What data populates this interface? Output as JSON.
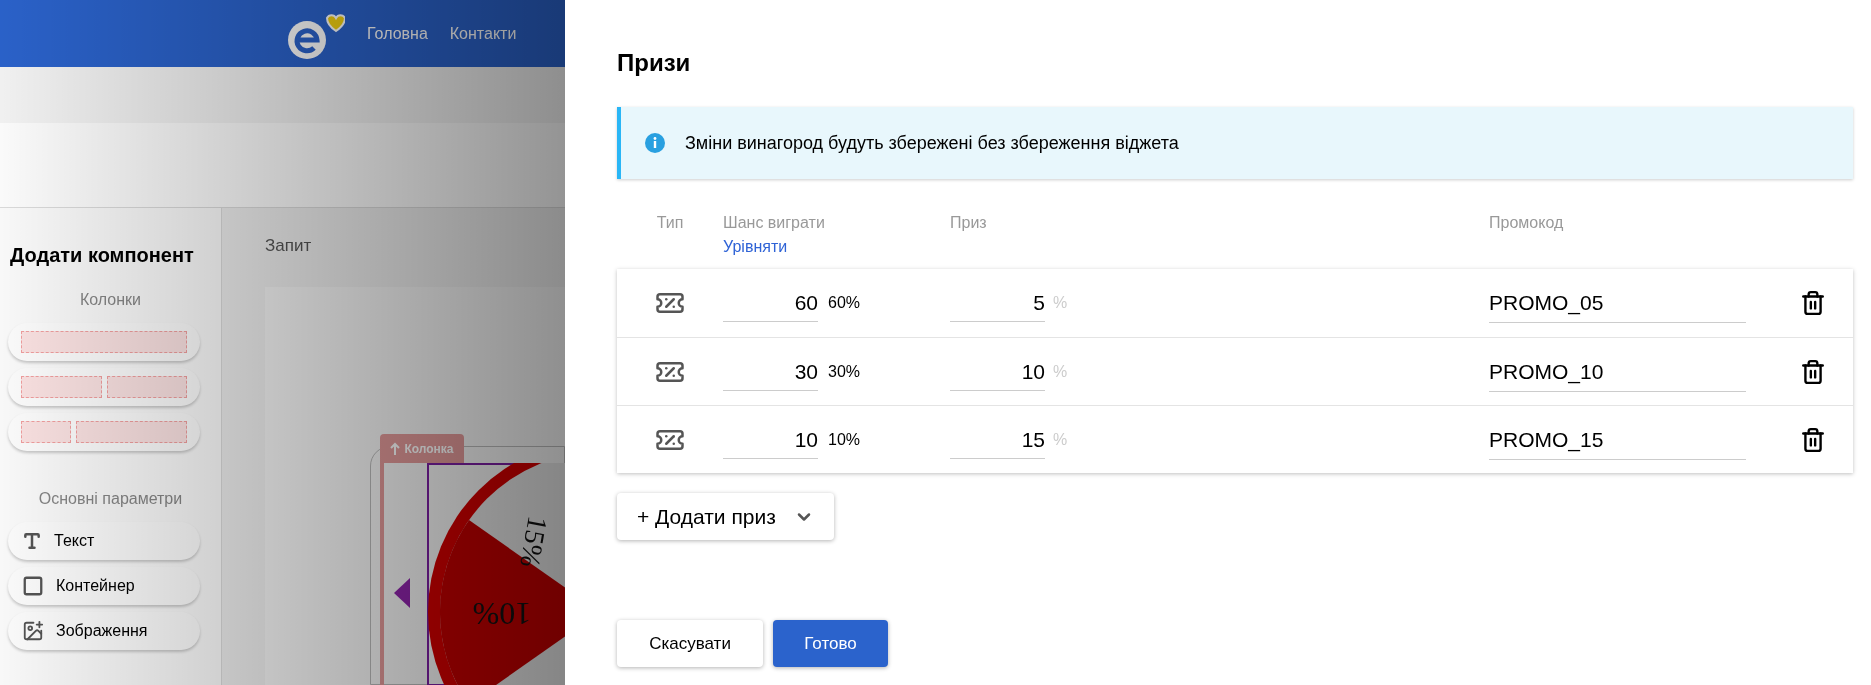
{
  "header": {
    "nav": [
      {
        "label": "Головна"
      },
      {
        "label": "Контакти"
      }
    ]
  },
  "sidebar": {
    "title": "Додати компонент",
    "sections": [
      {
        "heading": "Колонки",
        "items": [
          {
            "kind": "one-column"
          },
          {
            "kind": "two-columns"
          },
          {
            "kind": "narrow-wide"
          }
        ]
      },
      {
        "heading": "Основні параметри",
        "items": [
          {
            "kind": "text",
            "label": "Текст"
          },
          {
            "kind": "container",
            "label": "Контейнер"
          },
          {
            "kind": "image",
            "label": "Зображення"
          }
        ]
      }
    ]
  },
  "canvas": {
    "title": "Запит",
    "column_tag": "Колонка",
    "wheel_labels": [
      "10%",
      "15%"
    ]
  },
  "dialog": {
    "title": "Призи",
    "notice": "Зміни винагород будуть збережені без збереження віджета",
    "columns": {
      "type": "Тип",
      "chance": "Шанс виграти",
      "equalize": "Урівняти",
      "prize": "Приз",
      "promo": "Промокод"
    },
    "rows": [
      {
        "chance": "60",
        "share": "60%",
        "prize": "5",
        "unit": "%",
        "promo": "PROMO_05"
      },
      {
        "chance": "30",
        "share": "30%",
        "prize": "10",
        "unit": "%",
        "promo": "PROMO_10"
      },
      {
        "chance": "10",
        "share": "10%",
        "prize": "15",
        "unit": "%",
        "promo": "PROMO_15"
      }
    ],
    "add_button": "+ Додати приз",
    "buttons": [
      {
        "label": "Скасувати",
        "kind": "secondary"
      },
      {
        "label": "Готово",
        "kind": "primary"
      }
    ]
  }
}
